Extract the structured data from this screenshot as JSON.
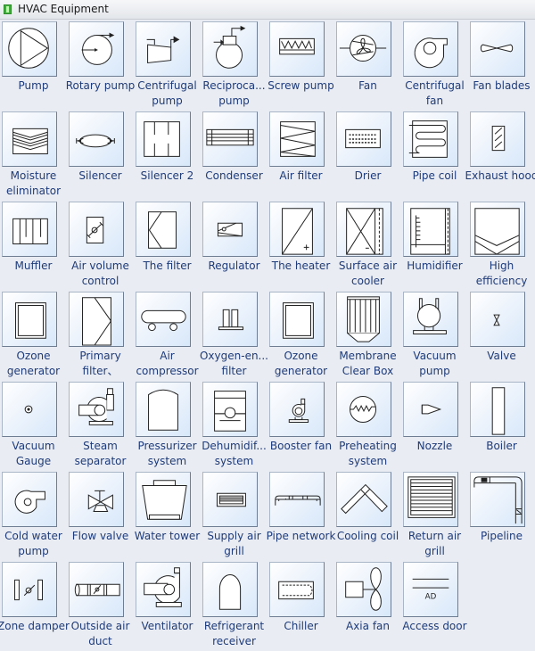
{
  "panel": {
    "title": "HVAC Equipment",
    "icon": "library-icon"
  },
  "items": [
    {
      "label": "Pump",
      "icon": "pump-icon"
    },
    {
      "label": "Rotary pump",
      "icon": "rotary-pump-icon"
    },
    {
      "label": "Centrifugal pump",
      "icon": "centrifugal-pump-icon"
    },
    {
      "label": "Reciproca... pump",
      "icon": "reciprocating-pump-icon"
    },
    {
      "label": "Screw pump",
      "icon": "screw-pump-icon"
    },
    {
      "label": "Fan",
      "icon": "fan-icon"
    },
    {
      "label": "Centrifugal fan",
      "icon": "centrifugal-fan-icon"
    },
    {
      "label": "Fan blades",
      "icon": "fan-blades-icon"
    },
    {
      "label": "Moisture eliminator",
      "icon": "moisture-eliminator-icon"
    },
    {
      "label": "Silencer",
      "icon": "silencer-icon"
    },
    {
      "label": "Silencer 2",
      "icon": "silencer-2-icon"
    },
    {
      "label": "Condenser",
      "icon": "condenser-icon"
    },
    {
      "label": "Air filter",
      "icon": "air-filter-icon"
    },
    {
      "label": "Drier",
      "icon": "drier-icon"
    },
    {
      "label": "Pipe coil",
      "icon": "pipe-coil-icon"
    },
    {
      "label": "Exhaust hood",
      "icon": "exhaust-hood-icon"
    },
    {
      "label": "Muffler",
      "icon": "muffler-icon"
    },
    {
      "label": "Air volume control",
      "icon": "air-volume-control-icon"
    },
    {
      "label": "The filter",
      "icon": "filter-icon"
    },
    {
      "label": "Regulator",
      "icon": "regulator-icon"
    },
    {
      "label": "The heater",
      "icon": "heater-icon"
    },
    {
      "label": "Surface air cooler",
      "icon": "surface-air-cooler-icon"
    },
    {
      "label": "Humidifier",
      "icon": "humidifier-icon"
    },
    {
      "label": "High efficiency",
      "icon": "high-efficiency-icon"
    },
    {
      "label": "Ozone generator",
      "icon": "ozone-generator-icon"
    },
    {
      "label": "Primary filter、",
      "icon": "primary-filter-icon"
    },
    {
      "label": "Air compressor",
      "icon": "air-compressor-icon"
    },
    {
      "label": "Oxygen-en... filter",
      "icon": "oxygen-enriched-filter-icon"
    },
    {
      "label": "Ozone generator",
      "icon": "ozone-generator-2-icon"
    },
    {
      "label": "Membrane Clear Box",
      "icon": "membrane-clear-box-icon"
    },
    {
      "label": "Vacuum pump",
      "icon": "vacuum-pump-icon"
    },
    {
      "label": "Valve",
      "icon": "valve-icon"
    },
    {
      "label": "Vacuum Gauge",
      "icon": "vacuum-gauge-icon"
    },
    {
      "label": "Steam separator",
      "icon": "steam-separator-icon"
    },
    {
      "label": "Pressurizer system",
      "icon": "pressurizer-system-icon"
    },
    {
      "label": "Dehumidif... system",
      "icon": "dehumidifier-system-icon"
    },
    {
      "label": "Booster fan",
      "icon": "booster-fan-icon"
    },
    {
      "label": "Preheating system",
      "icon": "preheating-system-icon"
    },
    {
      "label": "Nozzle",
      "icon": "nozzle-icon"
    },
    {
      "label": "Boiler",
      "icon": "boiler-icon"
    },
    {
      "label": "Cold water pump",
      "icon": "cold-water-pump-icon"
    },
    {
      "label": "Flow valve",
      "icon": "flow-valve-icon"
    },
    {
      "label": "Water tower",
      "icon": "water-tower-icon"
    },
    {
      "label": "Supply air grill",
      "icon": "supply-air-grill-icon"
    },
    {
      "label": "Pipe network",
      "icon": "pipe-network-icon"
    },
    {
      "label": "Cooling coil",
      "icon": "cooling-coil-icon"
    },
    {
      "label": "Return air grill",
      "icon": "return-air-grill-icon"
    },
    {
      "label": "Pipeline",
      "icon": "pipeline-icon"
    },
    {
      "label": "Zone damper",
      "icon": "zone-damper-icon"
    },
    {
      "label": "Outside air duct",
      "icon": "outside-air-duct-icon"
    },
    {
      "label": "Ventilator",
      "icon": "ventilator-icon"
    },
    {
      "label": "Refrigerant receiver",
      "icon": "refrigerant-receiver-icon"
    },
    {
      "label": "Chiller",
      "icon": "chiller-icon"
    },
    {
      "label": "Axia fan",
      "icon": "axial-fan-icon"
    },
    {
      "label": "Access door",
      "icon": "access-door-icon",
      "glyph_text": "AD"
    }
  ]
}
